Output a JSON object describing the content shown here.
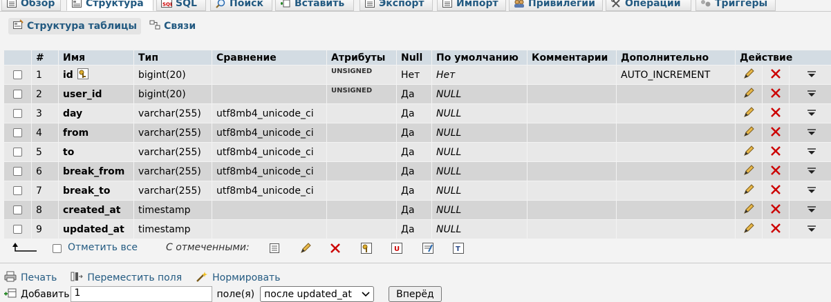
{
  "tabs": [
    {
      "label": "Обзор",
      "icon": "browse-icon"
    },
    {
      "label": "Структура",
      "icon": "structure-icon"
    },
    {
      "label": "SQL",
      "icon": "sql-icon"
    },
    {
      "label": "Поиск",
      "icon": "search-icon"
    },
    {
      "label": "Вставить",
      "icon": "insert-icon"
    },
    {
      "label": "Экспорт",
      "icon": "export-icon"
    },
    {
      "label": "Импорт",
      "icon": "import-icon"
    },
    {
      "label": "Привилегии",
      "icon": "privileges-icon"
    },
    {
      "label": "Операции",
      "icon": "operations-icon"
    },
    {
      "label": "Триггеры",
      "icon": "triggers-icon"
    }
  ],
  "subtabs": [
    {
      "label": "Структура таблицы",
      "icon": "table-structure-icon"
    },
    {
      "label": "Связи",
      "icon": "relations-icon"
    }
  ],
  "table": {
    "headers": [
      "#",
      "Имя",
      "Тип",
      "Сравнение",
      "Атрибуты",
      "Null",
      "По умолчанию",
      "Комментарии",
      "Дополнительно",
      "Действие"
    ],
    "rows": [
      {
        "num": "1",
        "name": "id",
        "type": "bigint(20)",
        "collation": "",
        "attributes": "UNSIGNED",
        "null": "Нет",
        "default": "Нет",
        "comments": "",
        "extra": "AUTO_INCREMENT",
        "primary": true
      },
      {
        "num": "2",
        "name": "user_id",
        "type": "bigint(20)",
        "collation": "",
        "attributes": "UNSIGNED",
        "null": "Да",
        "default": "NULL",
        "comments": "",
        "extra": ""
      },
      {
        "num": "3",
        "name": "day",
        "type": "varchar(255)",
        "collation": "utf8mb4_unicode_ci",
        "attributes": "",
        "null": "Да",
        "default": "NULL",
        "comments": "",
        "extra": ""
      },
      {
        "num": "4",
        "name": "from",
        "type": "varchar(255)",
        "collation": "utf8mb4_unicode_ci",
        "attributes": "",
        "null": "Да",
        "default": "NULL",
        "comments": "",
        "extra": ""
      },
      {
        "num": "5",
        "name": "to",
        "type": "varchar(255)",
        "collation": "utf8mb4_unicode_ci",
        "attributes": "",
        "null": "Да",
        "default": "NULL",
        "comments": "",
        "extra": ""
      },
      {
        "num": "6",
        "name": "break_from",
        "type": "varchar(255)",
        "collation": "utf8mb4_unicode_ci",
        "attributes": "",
        "null": "Да",
        "default": "NULL",
        "comments": "",
        "extra": ""
      },
      {
        "num": "7",
        "name": "break_to",
        "type": "varchar(255)",
        "collation": "utf8mb4_unicode_ci",
        "attributes": "",
        "null": "Да",
        "default": "NULL",
        "comments": "",
        "extra": ""
      },
      {
        "num": "8",
        "name": "created_at",
        "type": "timestamp",
        "collation": "",
        "attributes": "",
        "null": "Да",
        "default": "NULL",
        "comments": "",
        "extra": ""
      },
      {
        "num": "9",
        "name": "updated_at",
        "type": "timestamp",
        "collation": "",
        "attributes": "",
        "null": "Да",
        "default": "NULL",
        "comments": "",
        "extra": ""
      }
    ]
  },
  "bulk": {
    "check_all_label": "Отметить все",
    "with_selected_label": "С отмеченными:",
    "icons": [
      "browse-selected-icon",
      "edit-selected-icon",
      "drop-selected-icon",
      "primary-selected-icon",
      "unique-selected-icon",
      "index-selected-icon",
      "fulltext-selected-icon"
    ]
  },
  "tools": {
    "print_label": "Печать",
    "move_columns_label": "Переместить поля",
    "normalize_label": "Нормировать"
  },
  "add_column": {
    "add_label": "Добавить",
    "count_value": "1",
    "fields_label": "поле(я)",
    "position_selected": "после updated_at",
    "go_label": "Вперёд"
  },
  "colors": {
    "link": "#235a81",
    "header_bg": "#d3dce3",
    "row_odd": "#e8e8e8",
    "row_even": "#d5d5d5",
    "drop": "#cc0000"
  }
}
